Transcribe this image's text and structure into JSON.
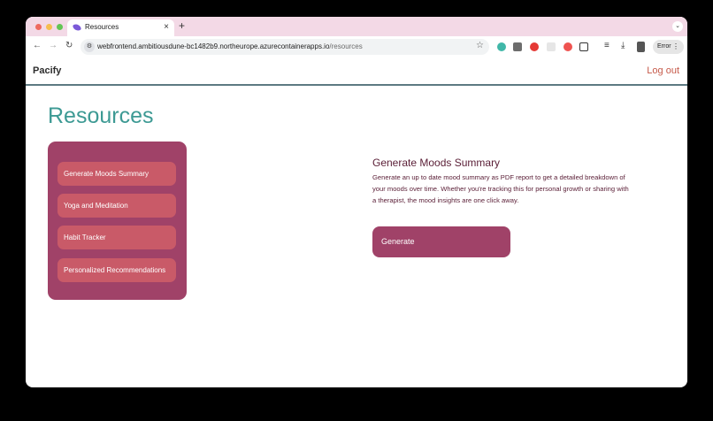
{
  "browser": {
    "tab_title": "Resources",
    "tab_close": "×",
    "new_tab": "+",
    "url_host": "webfrontend.ambitiousdune-bc1482b9.northeurope.azurecontainerapps.io",
    "url_path": "/resources",
    "error_label": "Error"
  },
  "header": {
    "brand": "Pacify",
    "logout_label": "Log out"
  },
  "page": {
    "title": "Resources"
  },
  "menu": {
    "items": [
      {
        "label": "Generate Moods Summary"
      },
      {
        "label": "Yoga and Meditation"
      },
      {
        "label": "Habit Tracker"
      },
      {
        "label": "Personalized Recommendations"
      }
    ]
  },
  "detail": {
    "title": "Generate Moods Summary",
    "description": "Generate an up to date mood summary as PDF report to get a detailed breakdown of your moods over time. Whether you're tracking this for personal growth or sharing with a therapist, the mood insights are one click away.",
    "button_label": "Generate"
  },
  "colors": {
    "accent_teal": "#3d9a94",
    "panel": "#a04268",
    "menu_item": "#c95a68",
    "logout": "#c65a4a",
    "tab_strip": "#f3d9e6"
  }
}
